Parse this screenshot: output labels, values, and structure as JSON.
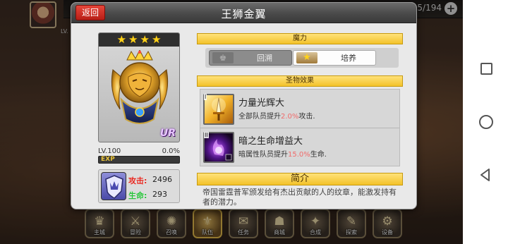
{
  "scene": {
    "counter": "5/194",
    "player_level": "LV.",
    "nav": [
      {
        "label": "主城",
        "glyph": "♛",
        "active": false
      },
      {
        "label": "冒险",
        "glyph": "⚔",
        "active": false
      },
      {
        "label": "召唤",
        "glyph": "✺",
        "active": false
      },
      {
        "label": "队伍",
        "glyph": "⚜",
        "active": true
      },
      {
        "label": "任务",
        "glyph": "✉",
        "active": false
      },
      {
        "label": "商城",
        "glyph": "☗",
        "active": false
      },
      {
        "label": "合成",
        "glyph": "✦",
        "active": false
      },
      {
        "label": "探索",
        "glyph": "✎",
        "active": false
      },
      {
        "label": "设备",
        "glyph": "⚙",
        "active": false
      }
    ]
  },
  "dialog": {
    "title": "王狮金翼",
    "back_label": "返回"
  },
  "relic": {
    "stars": 4,
    "rarity": "UR",
    "level_text": "LV.100",
    "exp_percent_text": "0.0%",
    "exp_label": "EXP",
    "exp_fraction": 0.0,
    "attack_label": "攻击:",
    "attack_value": "2496",
    "hp_label": "生命:",
    "hp_value": "293"
  },
  "magic": {
    "header": "魔力",
    "recall_label": "回溯",
    "train_label": "培养",
    "selected": "train"
  },
  "effects": {
    "header": "圣物效果",
    "items": [
      {
        "rank": "I",
        "name": "力量光辉大",
        "desc_pre": "全部队员提升",
        "desc_pct": "2.0%",
        "desc_post": "攻击."
      },
      {
        "rank": "II",
        "name": "暗之生命增益大",
        "desc_pre": "暗属性队员提升",
        "desc_pct": "15.0%",
        "desc_post": "生命."
      }
    ]
  },
  "intro": {
    "header": "简介",
    "text": "帝国雷霆普军颁发给有杰出贡献的人的纹章，能激发持有者的潜力。"
  },
  "colors": {
    "accent_yellow": "#f3c22a",
    "back_red": "#d2332a",
    "attack_red": "#e3241c",
    "hp_green": "#28c23a",
    "pct_red": "#f06a6a"
  }
}
